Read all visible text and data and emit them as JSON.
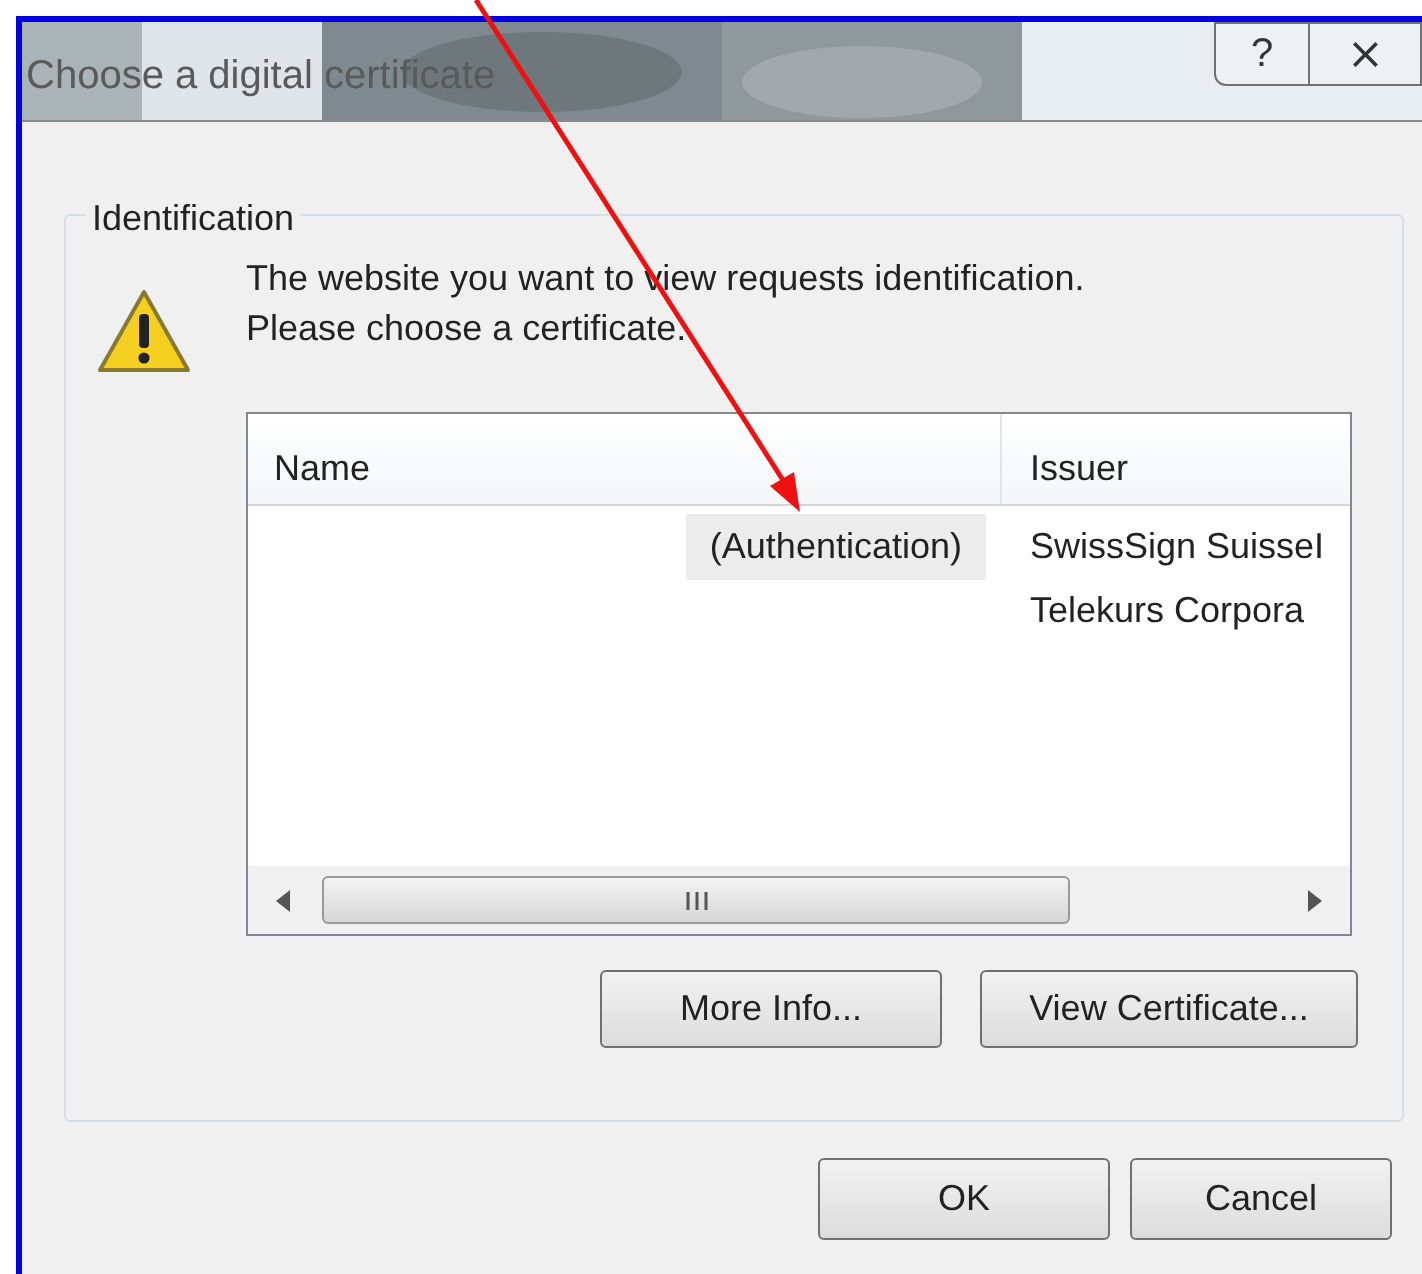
{
  "window": {
    "title": "Choose a digital certificate",
    "buttons": [
      "?",
      "⨯"
    ]
  },
  "group": {
    "title": "Identification",
    "message": "The website you want to view requests identification.\nPlease choose a certificate."
  },
  "table": {
    "columns": [
      "Name",
      "Issuer"
    ],
    "rows": [
      {
        "name": "(Authentication)",
        "issuer": "SwissSign SuisseI",
        "selected": true
      },
      {
        "name": "",
        "issuer": "Telekurs Corpora",
        "selected": false
      }
    ]
  },
  "list_buttons": [
    "More Info...",
    "View Certificate..."
  ],
  "buttons": [
    "OK",
    "Cancel"
  ]
}
